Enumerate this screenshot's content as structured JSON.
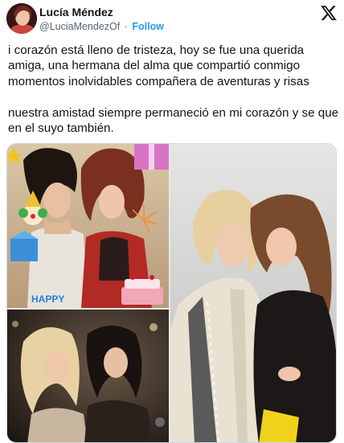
{
  "author": {
    "name": "Lucía Méndez",
    "handle": "@LuciaMendezOf",
    "separator": "·",
    "follow_label": "Follow"
  },
  "tweet": {
    "paragraph1": "i corazón está lleno de tristeza, hoy se fue una querida amiga, una hermana del alma que compartió conmigo momentos inolvidables compañera de aventuras y risas",
    "paragraph2": "nuestra amistad siempre permaneció en mi corazón y se que en el suyo también."
  },
  "media": {
    "photo_a_caption": "HAPPY"
  },
  "icons": {
    "x_logo": "x-logo-icon",
    "avatar": "profile-avatar"
  },
  "colors": {
    "accent": "#1d9bf0",
    "text": "#0f1419",
    "muted": "#536471"
  }
}
